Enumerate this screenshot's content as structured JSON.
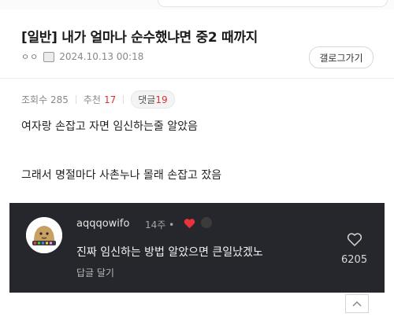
{
  "post": {
    "title": "[일반] 내가 얼마나 순수했냐면 중2 때까지",
    "author": "ㅇㅇ",
    "date": "2024.10.13 00:18",
    "gallery_button": "갤로그가기",
    "views_label": "조회수",
    "views": "285",
    "recommend_label": "추천",
    "recommend": "17",
    "comments_label": "댓글",
    "comments": "19",
    "body": [
      "여자랑 손잡고 자면 임신하는줄 알았음",
      "그래서 명절마다 사촌누나 몰래 손잡고 잤음"
    ]
  },
  "comment": {
    "username": "aqqqowifo",
    "time": "14주 •",
    "text": "진짜 임신하는 방법 알았으면 큰일났겠노",
    "reply_label": "답글 달기",
    "likes": "6205"
  },
  "icons": {
    "level": "level-icon",
    "heart": "heart-icon",
    "like": "like-heart-outline-icon",
    "scroll_top": "chevron-up-icon"
  },
  "colors": {
    "accent_red": "#d33333",
    "comment_bg": "#26272c"
  }
}
